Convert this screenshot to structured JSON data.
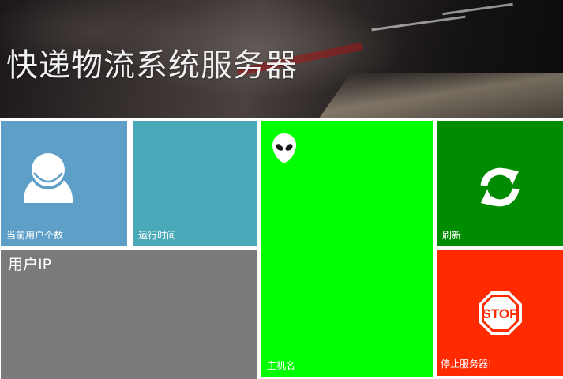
{
  "header": {
    "title": "快递物流系统服务器"
  },
  "tiles": {
    "current_users": {
      "label": "当前用户个数",
      "icon": "user-icon",
      "color": "#5e9fc7"
    },
    "runtime": {
      "label": "运行时间",
      "color": "#4aa9b8"
    },
    "user_ip": {
      "heading": "用户IP",
      "color": "#7a7a7a"
    },
    "hostname": {
      "label": "主机名",
      "icon": "alien-icon",
      "color": "#00ff00"
    },
    "refresh": {
      "label": "刷新",
      "icon": "refresh-icon",
      "color": "#008c00"
    },
    "stop_server": {
      "label": "停止服务器!",
      "icon": "stop-sign-icon",
      "icon_text": "STOP",
      "color": "#ff2a00"
    }
  }
}
